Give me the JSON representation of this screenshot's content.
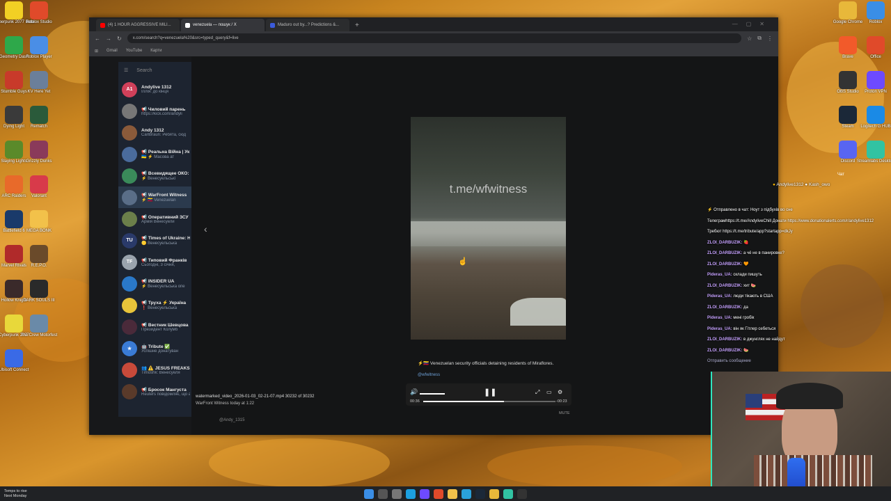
{
  "browser": {
    "tabs": [
      {
        "label": "(4) 1 HOUR AGGRESSIVE MILI...",
        "color": "#ff0000",
        "active": false
      },
      {
        "label": "venezuela — пошук / X",
        "color": "#ffffff",
        "active": true
      },
      {
        "label": "Maduro out by...? Predictions &...",
        "color": "#3b5bdb",
        "active": false
      }
    ],
    "url": "x.com/search?q=venezuela%20&src=typed_query&f=live",
    "bookmarks": [
      "Gmail",
      "YouTube",
      "Карти"
    ]
  },
  "telegram": {
    "search_placeholder": "Search",
    "chats": [
      {
        "name": "Andylive 1312",
        "msg": "Іллія: до кінця",
        "avatar": "A1",
        "color": "#d0405a"
      },
      {
        "name": "📢 Чиловий парень",
        "msg": "https://kick.com/andyli",
        "avatar": "",
        "color": "#777"
      },
      {
        "name": "Andy 1312",
        "msg": "CarlBraun: Ребята, сюд",
        "avatar": "",
        "color": "#8a5a3a"
      },
      {
        "name": "📢 Реальна Війна | Ук",
        "msg": "🇺🇦 ⚡ Масова ат",
        "avatar": "",
        "color": "#4a6b9c"
      },
      {
        "name": "📢 Всевидящее ОКО: Укр",
        "msg": "⚡ Венесуельські",
        "avatar": "",
        "color": "#3a8a5a"
      },
      {
        "name": "📢 WarFront Witness",
        "msg": "⚡ 🇻🇪 Venezuelan",
        "avatar": "",
        "color": "#5a6e88"
      },
      {
        "name": "📢 Оперативний ЗСУ",
        "msg": "Армія Венесуели",
        "avatar": "",
        "color": "#6b7f4a"
      },
      {
        "name": "📢 Times of Ukraine: Н",
        "msg": "🟡 Венесуельська",
        "avatar": "TU",
        "color": "#2a3a6a"
      },
      {
        "name": "📢 Типовий Франків",
        "msg": "Сьогодні, 3 січня,",
        "avatar": "TF",
        "color": "#9aa3ad"
      },
      {
        "name": "📢 INSIDER UA",
        "msg": "⚡ Венесуельська опе",
        "avatar": "",
        "color": "#2a78c8"
      },
      {
        "name": "📢 Труха ⚡ Україна",
        "msg": "❗ Венесуельська",
        "avatar": "",
        "color": "#e8c43a"
      },
      {
        "name": "📢 Вестник Шевцова",
        "msg": "Президент Колумб",
        "avatar": "",
        "color": "#4a2a3a"
      },
      {
        "name": "🤖 Tribute ✅",
        "msg": "Успішне донатуван",
        "avatar": "★",
        "color": "#3a7bd5"
      },
      {
        "name": "👥 ⚠️ JESUS FREAKS",
        "msg": "Timoshk: Венесуеля",
        "avatar": "",
        "color": "#c84a3a"
      },
      {
        "name": "📢 Бросок Мангуста",
        "msg": "Reuters повідомляє, що американські солдати зараз діють на місцях у Каракасі та його околи",
        "avatar": "",
        "color": "#5a3a2a"
      }
    ]
  },
  "media": {
    "watermark": "t.me/wfwitness",
    "caption": "⚡🇻🇪 Venezuelan security officials detaining residents of Miraflores.",
    "handle": "@wfwitness",
    "time_current": "00:36",
    "time_remaining": "-00:23",
    "progress_fraction": 0.61,
    "volume_fraction": 1.0,
    "file_name": "watermarked_video_2026-01-03_02-21-07.mp4 30232 of 30232",
    "file_sub": "WarFront Witness  today at 1:22",
    "mute_label": "MUTE",
    "page_handle": "@Andy_1315"
  },
  "stream": {
    "header_left": "Andylive1312",
    "header_right": "Kash_owo",
    "right_label": "Чат",
    "lines": [
      {
        "user": "",
        "text": "⚡ Отправлено в чат: Ноут з підбухів во сне"
      },
      {
        "user": "",
        "text": "Телеграмhttps://t.me/AndyliveChill Донати https://www.donationalerts.com/r/andylive1312"
      },
      {
        "user": "",
        "text": "Требют https://t.me/tribute/app?startapp=dkJy"
      },
      {
        "user": "ZLOI_DARBUZIK:",
        "text": " 🍓"
      },
      {
        "user": "ZLOI_DARBUZIK:",
        "text": " а чё не в панировке?"
      },
      {
        "user": "ZLOI_DARBUZIK:",
        "text": " 🧡"
      },
      {
        "user": "Pideras_UA:",
        "text": " склади пишуть"
      },
      {
        "user": "ZLOI_DARBUZIK:",
        "text": " хит 🍉"
      },
      {
        "user": "Pideras_UA:",
        "text": " люди тікають в США"
      },
      {
        "user": "ZLOI_DARBUZIK:",
        "text": " да"
      },
      {
        "user": "Pideras_UA:",
        "text": " мені гробік"
      },
      {
        "user": "Pideras_UA:",
        "text": " він як Гітлер себеться"
      },
      {
        "user": "ZLOI_DARBUZIK:",
        "text": " в джунглях не найдут"
      },
      {
        "user": "ZLOI_DARBUZIK:",
        "text": " 🍉"
      }
    ],
    "input_placeholder": "Отправить сообщение"
  },
  "desktop": {
    "left_icons": [
      "Cyberpunk 2077 Beta",
      "Roblox Studio",
      "Geometry Dash",
      "Roblox Player",
      "Stumble Guys",
      "KV Here Yet",
      "Dying Light",
      "Rematch",
      "Slaying Lights",
      "Grizzly Dunks",
      "ARC Raiders",
      "Valorant",
      "Battlefield 6",
      "MEGA BONK",
      "Marvel Rivals",
      "R.E.P.O.",
      "Hollow Knight",
      "DARK SOULS III",
      "Cyberpunk 2077",
      "The Crew Motorfest",
      "Ubisoft Connect"
    ],
    "right_icons": [
      "Roblox",
      "Google Chrome",
      "Office",
      "Brave",
      "Proton VPN",
      "OBS Studio",
      "Logitech G HUB",
      "Steam",
      "Streamlabs Desktop",
      "Discord",
      "NVIDIA app"
    ],
    "weather": [
      "Temps to rise",
      "Next Monday"
    ]
  }
}
